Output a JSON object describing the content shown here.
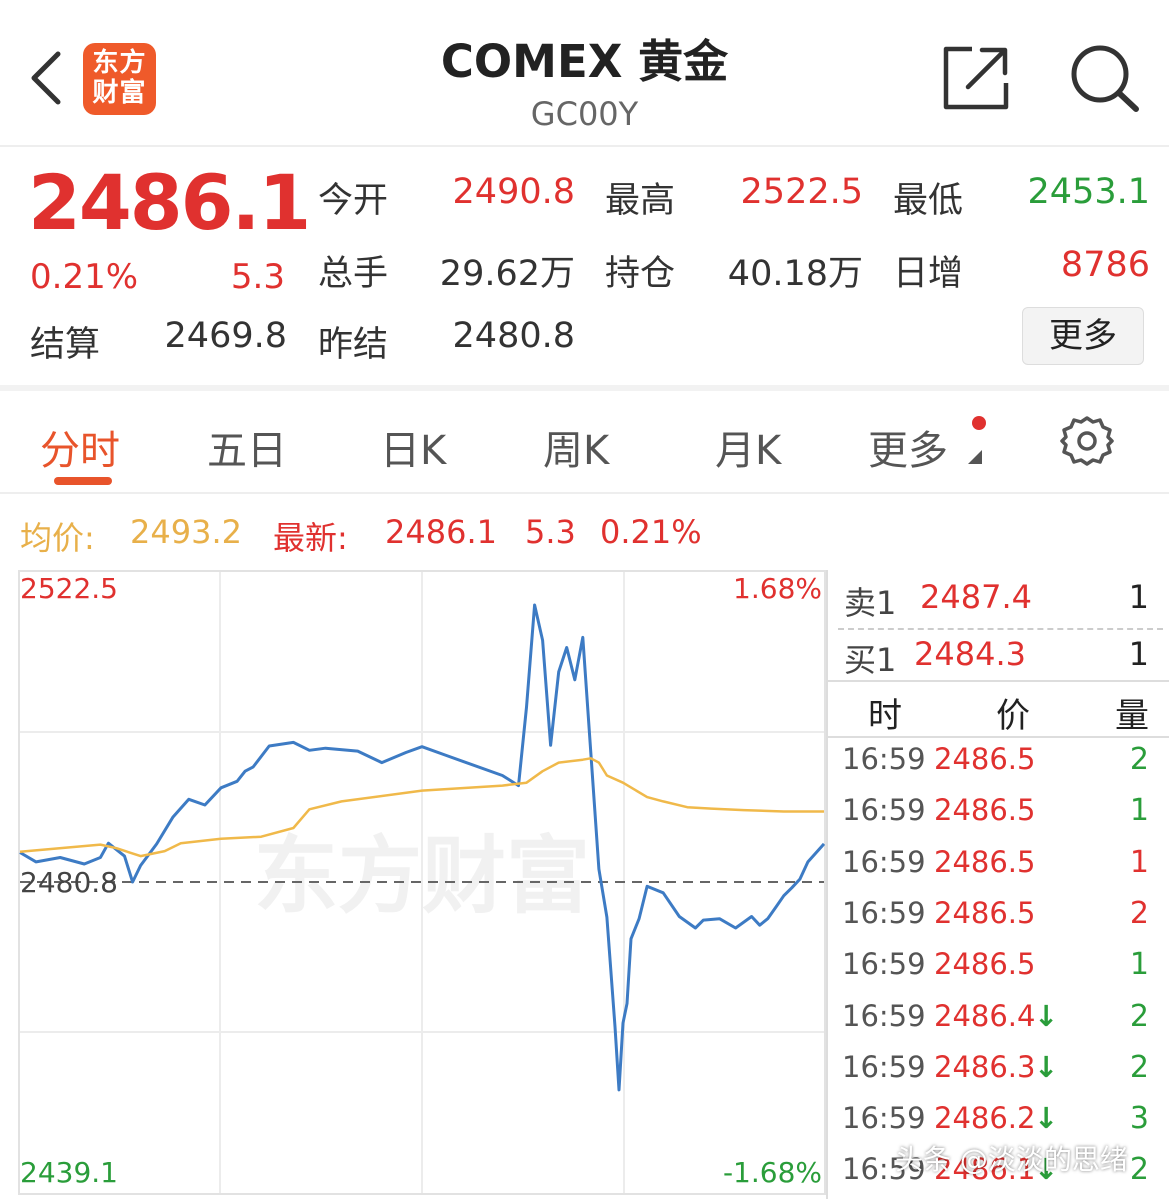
{
  "header": {
    "logo_line1": "东方",
    "logo_line2": "财富",
    "title": "COMEX 黄金",
    "code": "GC00Y"
  },
  "quote": {
    "last": "2486.1",
    "change_pct": "0.21%",
    "change": "5.3",
    "open_label": "今开",
    "open": "2490.8",
    "high_label": "最高",
    "high": "2522.5",
    "low_label": "最低",
    "low": "2453.1",
    "volume_label": "总手",
    "volume": "29.62万",
    "oi_label": "持仓",
    "oi": "40.18万",
    "daily_inc_label": "日增",
    "daily_inc": "8786",
    "settle_label": "结算",
    "settle": "2469.8",
    "prev_settle_label": "昨结",
    "prev_settle": "2480.8",
    "more_label": "更多"
  },
  "tabs": [
    "分时",
    "五日",
    "日K",
    "周K",
    "月K",
    "更多"
  ],
  "info_line": {
    "avg_label": "均价:",
    "avg": "2493.2",
    "latest_label": "最新:",
    "latest": "2486.1",
    "latest_change": "5.3",
    "latest_pct": "0.21%"
  },
  "chart_data": {
    "type": "line",
    "y_top_label": "2522.5",
    "y_bottom_label": "2439.1",
    "y_ref_label": "2480.8",
    "pct_top_label": "1.68%",
    "pct_bottom_label": "-1.68%",
    "ylim": [
      2439.1,
      2522.5
    ],
    "reference": 2480.8,
    "watermark": "东方财富",
    "series": [
      {
        "x": [
          0,
          0.02,
          0.05,
          0.08,
          0.1,
          0.11,
          0.13,
          0.14,
          0.15,
          0.17,
          0.19,
          0.21,
          0.23,
          0.25,
          0.27,
          0.28,
          0.29,
          0.31,
          0.34,
          0.36,
          0.38,
          0.42,
          0.45,
          0.48,
          0.5,
          0.53,
          0.6,
          0.62,
          0.63,
          0.64,
          0.65,
          0.66,
          0.67,
          0.68,
          0.69,
          0.7,
          0.71,
          0.72,
          0.73,
          0.74,
          0.745,
          0.75,
          0.755,
          0.76,
          0.77,
          0.78,
          0.8,
          0.82,
          0.84,
          0.85,
          0.87,
          0.89,
          0.91,
          0.92,
          0.93,
          0.94,
          0.95,
          0.96,
          0.97,
          0.98,
          1.0
        ],
        "values": [
          2484.9,
          2483.6,
          2484.2,
          2483.3,
          2484.2,
          2486.2,
          2484.4,
          2480.8,
          2483.1,
          2486.1,
          2489.8,
          2492.3,
          2491.5,
          2493.9,
          2494.8,
          2496.2,
          2496.8,
          2499.7,
          2500.2,
          2499.1,
          2499.4,
          2499.0,
          2497.4,
          2498.8,
          2499.6,
          2498.4,
          2495.6,
          2494.2,
          2505.1,
          2519.3,
          2514.4,
          2499.8,
          2510.0,
          2513.4,
          2508.9,
          2514.8,
          2498.8,
          2482.6,
          2475.9,
          2460.7,
          2451.9,
          2461.2,
          2463.9,
          2472.9,
          2475.7,
          2480.2,
          2479.3,
          2476.0,
          2474.4,
          2475.5,
          2475.7,
          2474.4,
          2476.0,
          2474.8,
          2475.7,
          2477.3,
          2478.9,
          2480.0,
          2481.2,
          2483.6,
          2486.1
        ]
      },
      {
        "name": "均价",
        "x": [
          0,
          0.1,
          0.12,
          0.15,
          0.18,
          0.2,
          0.25,
          0.3,
          0.34,
          0.36,
          0.4,
          0.5,
          0.6,
          0.63,
          0.65,
          0.67,
          0.7,
          0.71,
          0.72,
          0.73,
          0.75,
          0.78,
          0.8,
          0.83,
          0.86,
          0.9,
          0.95,
          1.0
        ],
        "values": [
          2485.0,
          2486.0,
          2485.5,
          2484.4,
          2485.1,
          2486.2,
          2486.8,
          2487.1,
          2488.3,
          2490.9,
          2492.0,
          2493.5,
          2494.2,
          2494.6,
          2496.2,
          2497.4,
          2497.8,
          2498.0,
          2497.4,
          2495.6,
          2494.6,
          2492.6,
          2492.0,
          2491.2,
          2491.0,
          2490.8,
          2490.6,
          2490.6
        ]
      }
    ]
  },
  "order_book": {
    "ask_label": "卖1",
    "ask_price": "2487.4",
    "ask_qty": "1",
    "bid_label": "买1",
    "bid_price": "2484.3",
    "bid_qty": "1",
    "col_time": "时",
    "col_price": "价",
    "col_qty": "量"
  },
  "ticks": [
    {
      "time": "16:59",
      "price": "2486.5",
      "qty": "2",
      "dir": "",
      "qty_color": "#2a9d3a"
    },
    {
      "time": "16:59",
      "price": "2486.5",
      "qty": "1",
      "dir": "",
      "qty_color": "#2a9d3a"
    },
    {
      "time": "16:59",
      "price": "2486.5",
      "qty": "1",
      "dir": "",
      "qty_color": "#e0312f"
    },
    {
      "time": "16:59",
      "price": "2486.5",
      "qty": "2",
      "dir": "",
      "qty_color": "#e0312f"
    },
    {
      "time": "16:59",
      "price": "2486.5",
      "qty": "1",
      "dir": "",
      "qty_color": "#2a9d3a"
    },
    {
      "time": "16:59",
      "price": "2486.4",
      "qty": "2",
      "dir": "↓",
      "qty_color": "#2a9d3a"
    },
    {
      "time": "16:59",
      "price": "2486.3",
      "qty": "2",
      "dir": "↓",
      "qty_color": "#2a9d3a"
    },
    {
      "time": "16:59",
      "price": "2486.2",
      "qty": "3",
      "dir": "↓",
      "qty_color": "#2a9d3a"
    },
    {
      "time": "16:59",
      "price": "2486.1",
      "qty": "2",
      "dir": "↓",
      "qty_color": "#2a9d3a"
    }
  ],
  "colors": {
    "up": "#e0312f",
    "down": "#2a9d3a",
    "price_line": "#3d7bc4",
    "avg_line": "#f0b94a",
    "accent": "#e8542b"
  },
  "watermark_text": "头条 @淡淡的思绪"
}
